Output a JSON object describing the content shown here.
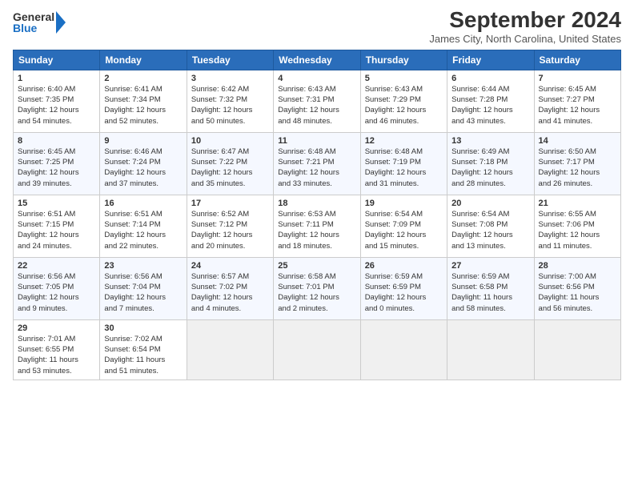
{
  "header": {
    "logo_line1": "General",
    "logo_line2": "Blue",
    "month": "September 2024",
    "location": "James City, North Carolina, United States"
  },
  "days_of_week": [
    "Sunday",
    "Monday",
    "Tuesday",
    "Wednesday",
    "Thursday",
    "Friday",
    "Saturday"
  ],
  "weeks": [
    [
      {
        "day": "1",
        "info": "Sunrise: 6:40 AM\nSunset: 7:35 PM\nDaylight: 12 hours\nand 54 minutes."
      },
      {
        "day": "2",
        "info": "Sunrise: 6:41 AM\nSunset: 7:34 PM\nDaylight: 12 hours\nand 52 minutes."
      },
      {
        "day": "3",
        "info": "Sunrise: 6:42 AM\nSunset: 7:32 PM\nDaylight: 12 hours\nand 50 minutes."
      },
      {
        "day": "4",
        "info": "Sunrise: 6:43 AM\nSunset: 7:31 PM\nDaylight: 12 hours\nand 48 minutes."
      },
      {
        "day": "5",
        "info": "Sunrise: 6:43 AM\nSunset: 7:29 PM\nDaylight: 12 hours\nand 46 minutes."
      },
      {
        "day": "6",
        "info": "Sunrise: 6:44 AM\nSunset: 7:28 PM\nDaylight: 12 hours\nand 43 minutes."
      },
      {
        "day": "7",
        "info": "Sunrise: 6:45 AM\nSunset: 7:27 PM\nDaylight: 12 hours\nand 41 minutes."
      }
    ],
    [
      {
        "day": "8",
        "info": "Sunrise: 6:45 AM\nSunset: 7:25 PM\nDaylight: 12 hours\nand 39 minutes."
      },
      {
        "day": "9",
        "info": "Sunrise: 6:46 AM\nSunset: 7:24 PM\nDaylight: 12 hours\nand 37 minutes."
      },
      {
        "day": "10",
        "info": "Sunrise: 6:47 AM\nSunset: 7:22 PM\nDaylight: 12 hours\nand 35 minutes."
      },
      {
        "day": "11",
        "info": "Sunrise: 6:48 AM\nSunset: 7:21 PM\nDaylight: 12 hours\nand 33 minutes."
      },
      {
        "day": "12",
        "info": "Sunrise: 6:48 AM\nSunset: 7:19 PM\nDaylight: 12 hours\nand 31 minutes."
      },
      {
        "day": "13",
        "info": "Sunrise: 6:49 AM\nSunset: 7:18 PM\nDaylight: 12 hours\nand 28 minutes."
      },
      {
        "day": "14",
        "info": "Sunrise: 6:50 AM\nSunset: 7:17 PM\nDaylight: 12 hours\nand 26 minutes."
      }
    ],
    [
      {
        "day": "15",
        "info": "Sunrise: 6:51 AM\nSunset: 7:15 PM\nDaylight: 12 hours\nand 24 minutes."
      },
      {
        "day": "16",
        "info": "Sunrise: 6:51 AM\nSunset: 7:14 PM\nDaylight: 12 hours\nand 22 minutes."
      },
      {
        "day": "17",
        "info": "Sunrise: 6:52 AM\nSunset: 7:12 PM\nDaylight: 12 hours\nand 20 minutes."
      },
      {
        "day": "18",
        "info": "Sunrise: 6:53 AM\nSunset: 7:11 PM\nDaylight: 12 hours\nand 18 minutes."
      },
      {
        "day": "19",
        "info": "Sunrise: 6:54 AM\nSunset: 7:09 PM\nDaylight: 12 hours\nand 15 minutes."
      },
      {
        "day": "20",
        "info": "Sunrise: 6:54 AM\nSunset: 7:08 PM\nDaylight: 12 hours\nand 13 minutes."
      },
      {
        "day": "21",
        "info": "Sunrise: 6:55 AM\nSunset: 7:06 PM\nDaylight: 12 hours\nand 11 minutes."
      }
    ],
    [
      {
        "day": "22",
        "info": "Sunrise: 6:56 AM\nSunset: 7:05 PM\nDaylight: 12 hours\nand 9 minutes."
      },
      {
        "day": "23",
        "info": "Sunrise: 6:56 AM\nSunset: 7:04 PM\nDaylight: 12 hours\nand 7 minutes."
      },
      {
        "day": "24",
        "info": "Sunrise: 6:57 AM\nSunset: 7:02 PM\nDaylight: 12 hours\nand 4 minutes."
      },
      {
        "day": "25",
        "info": "Sunrise: 6:58 AM\nSunset: 7:01 PM\nDaylight: 12 hours\nand 2 minutes."
      },
      {
        "day": "26",
        "info": "Sunrise: 6:59 AM\nSunset: 6:59 PM\nDaylight: 12 hours\nand 0 minutes."
      },
      {
        "day": "27",
        "info": "Sunrise: 6:59 AM\nSunset: 6:58 PM\nDaylight: 11 hours\nand 58 minutes."
      },
      {
        "day": "28",
        "info": "Sunrise: 7:00 AM\nSunset: 6:56 PM\nDaylight: 11 hours\nand 56 minutes."
      }
    ],
    [
      {
        "day": "29",
        "info": "Sunrise: 7:01 AM\nSunset: 6:55 PM\nDaylight: 11 hours\nand 53 minutes."
      },
      {
        "day": "30",
        "info": "Sunrise: 7:02 AM\nSunset: 6:54 PM\nDaylight: 11 hours\nand 51 minutes."
      },
      {
        "day": "",
        "info": ""
      },
      {
        "day": "",
        "info": ""
      },
      {
        "day": "",
        "info": ""
      },
      {
        "day": "",
        "info": ""
      },
      {
        "day": "",
        "info": ""
      }
    ]
  ]
}
